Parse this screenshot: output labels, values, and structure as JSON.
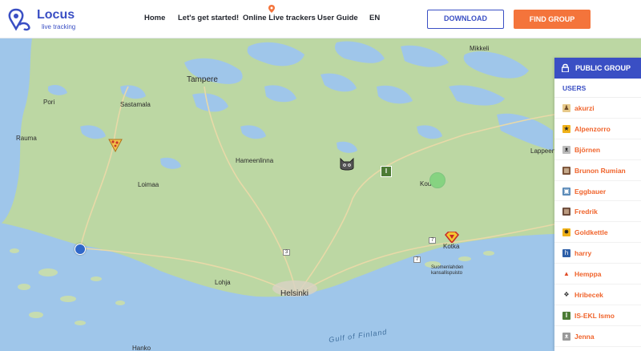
{
  "app": {
    "title": "Locus",
    "subtitle": "live tracking"
  },
  "nav": {
    "items": [
      {
        "label": "Home"
      },
      {
        "label": "Let's get started!"
      },
      {
        "label": "Online Live trackers"
      },
      {
        "label": "User Guide"
      },
      {
        "label": "EN"
      }
    ],
    "download_label": "DOWNLOAD",
    "find_group_label": "FIND GROUP"
  },
  "map": {
    "places": [
      "Pori",
      "Tampere",
      "Sastamala",
      "Rauma",
      "Hameenlinna",
      "Loimaa",
      "Kou",
      "Lappeen",
      "Mikkeli",
      "Helsinki",
      "Lohja",
      "Kotka",
      "Hanko",
      "Gulf of Finland",
      "Suomenlahden kansallispuisto"
    ],
    "route_numbers": [
      "3",
      "7",
      "7"
    ],
    "markers": [
      {
        "name": "pizza",
        "icon": "pizza-icon"
      },
      {
        "name": "cat",
        "icon": "cat-icon"
      },
      {
        "name": "IS-EKL Ismo",
        "icon": "letter-I-icon",
        "letter": "I"
      },
      {
        "name": "green-dot",
        "icon": "dot-icon"
      },
      {
        "name": "superman",
        "icon": "superman-icon"
      },
      {
        "name": "blue-dot",
        "icon": "dot-icon"
      }
    ]
  },
  "panel": {
    "title": "PUBLIC GROUP",
    "users_heading": "USERS",
    "users": [
      {
        "name": "akurzi",
        "icon": "person-icon",
        "color": "#e7c98a",
        "glyph": "♟"
      },
      {
        "name": "Alpenzorro",
        "icon": "mask-icon",
        "color": "#f0b21a",
        "glyph": "★"
      },
      {
        "name": "Björnen",
        "icon": "bear-icon",
        "color": "#bbbbbb",
        "glyph": "ᴥ"
      },
      {
        "name": "Brunon Rumian",
        "icon": "photo-icon",
        "color": "#7a5238",
        "glyph": "▦"
      },
      {
        "name": "Eggbauer",
        "icon": "tractor-icon",
        "color": "#5a8ab8",
        "glyph": "▣"
      },
      {
        "name": "Fredrik",
        "icon": "photo-icon",
        "color": "#6b4a3a",
        "glyph": "▦"
      },
      {
        "name": "Goldkettle",
        "icon": "star-icon",
        "color": "#f0b21a",
        "glyph": "✸"
      },
      {
        "name": "harry",
        "icon": "badge-icon",
        "color": "#2d5fa8",
        "glyph": "h"
      },
      {
        "name": "Hemppa",
        "icon": "fire-icon",
        "color": "#e04b26",
        "glyph": "▲"
      },
      {
        "name": "Hribecek",
        "icon": "paw-icon",
        "color": "#333333",
        "glyph": "❖"
      },
      {
        "name": "IS-EKL Ismo",
        "icon": "letter-I-icon",
        "color": "#4c7b35",
        "glyph": "I"
      },
      {
        "name": "Jenna",
        "icon": "cat-icon",
        "color": "#9a9a9a",
        "glyph": "ᴥ"
      }
    ]
  },
  "colors": {
    "accent": "#3a4fc4",
    "orange": "#f4743b",
    "user_name": "#f0642c"
  }
}
